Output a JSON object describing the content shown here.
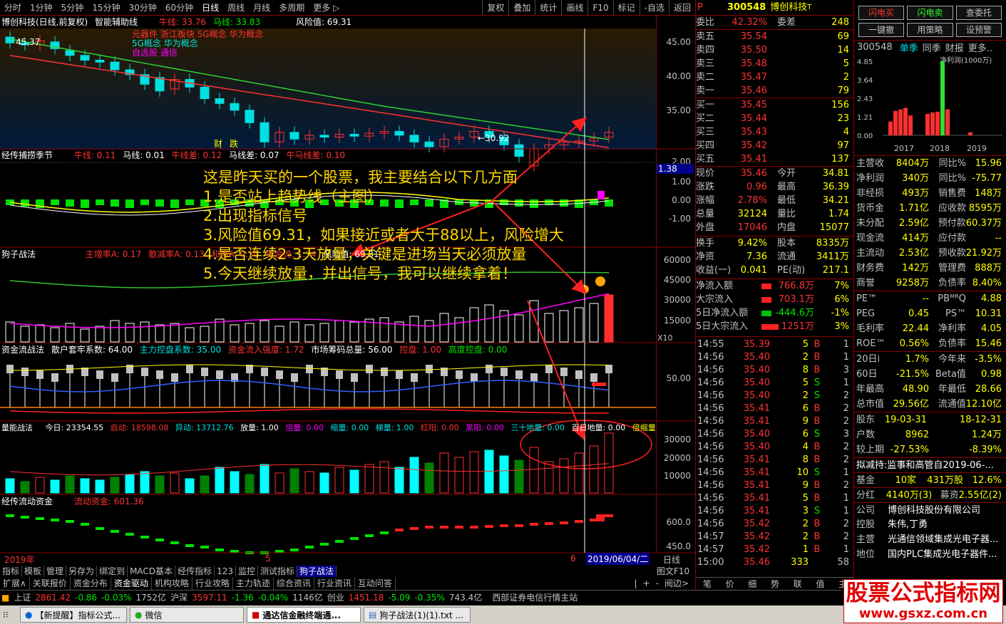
{
  "topbar": {
    "periods": [
      "分时",
      "1分钟",
      "5分钟",
      "15分钟",
      "30分钟",
      "60分钟",
      "日线",
      "周线",
      "月线",
      "多周期",
      "更多 ▷"
    ],
    "active_period": "日线",
    "tools": [
      "复权",
      "叠加",
      "统计",
      "画线",
      "F10",
      "标记",
      "-自选",
      "返回"
    ]
  },
  "main_panel": {
    "title": "博创科技(日线,前复权)",
    "indicator": "智能辅助线",
    "niu": "牛线: 33.76",
    "ma": "马线: 33.83",
    "risk": "风险值: 69.31",
    "concepts": [
      "元器件 浙江板块 5G概念 华为概念",
      "5G概念 华为概念",
      "自选股 通信"
    ],
    "price_high": "45.37",
    "price_low": "←30.92",
    "markers": [
      "财",
      "跌"
    ],
    "axis": [
      "45.00",
      "40.00",
      "35.00"
    ]
  },
  "panel2": {
    "title": "经传捕捞季节",
    "vals": [
      "牛线: 0.11",
      "马线: 0.01",
      "牛线差: 0.12",
      "马线差: 0.07",
      "牛马线差: 0.10"
    ],
    "axis": [
      "2.00",
      "1.00",
      "0.00",
      "-1.00"
    ],
    "badge": "1.38"
  },
  "panel3": {
    "title": "狗子战法",
    "vals": [
      "主增率A: 0.17",
      "散减率A: 0.13",
      "和率A: 0.30",
      "资金流: 1.74",
      "风险值: 69.31"
    ],
    "axis": [
      "60000",
      "45000",
      "30000",
      "15000"
    ],
    "scale": "X10"
  },
  "panel4": {
    "title": "资金流战法",
    "vals": [
      "散户套牢系数: 64.00",
      "主力控盘系数: 35.00",
      "资金流入强度: 1.72",
      "市场筹码总量: 56.00",
      "控盘: 1.00",
      "高度控盘: 0.00"
    ],
    "axis": [
      "50.00"
    ]
  },
  "panel5": {
    "title": "量能战法",
    "vals": [
      "今日: 23354.55",
      "启动: 18598.08",
      "异动: 13712.76",
      "放量: 1.00",
      "倍量: 0.00",
      "缩量: 0.00",
      "梯量: 1.00",
      "红阳: 0.00",
      "黑阳: 0.00",
      "三十地量: 0.00",
      "百日地量: 0.00",
      "倍缩量"
    ],
    "axis": [
      "30000",
      "20000",
      "10000"
    ]
  },
  "panel6": {
    "title": "经传流动资金",
    "vals": [
      "流动资金: 601.36"
    ],
    "axis": [
      "600.0",
      "450.0"
    ]
  },
  "xaxis": {
    "year": "2019年",
    "m5": "5",
    "m6": "6",
    "cursor": "2019/06/04/二",
    "right": "日线"
  },
  "bottom_tabs": [
    "指标",
    "模板",
    "管理",
    "另存为",
    "绑定到",
    "MACD基本",
    "经传指标",
    "123",
    "监控",
    "测试指标",
    "狗子战法"
  ],
  "bottom_tabs2": [
    "扩展∧",
    "关联报价",
    "资金分布",
    "资金驱动",
    "机构攻略",
    "行业攻略",
    "主力轨迹",
    "综合资讯",
    "行业资讯",
    "互动问答"
  ],
  "bottom_right": [
    "图文F10",
    "|",
    "+",
    "-",
    "阅边>"
  ],
  "annotation": [
    "这是昨天买的一个股票，我主要结合以下几方面",
    "1.是否站上趋势线（主图）",
    "2.出现指标信号",
    "3.风险值69.31，如果接近或者大于88以上，风险增大",
    "4.是否连续2-3天放量，关键是进场当天必须放量",
    "5.今天继续放量，并出信号，我可以继续拿着！"
  ],
  "quote": {
    "code": "300548",
    "name": "博创科技",
    "weibi": [
      "委比",
      "42.32%",
      "委差",
      "248"
    ],
    "sells": [
      [
        "卖五",
        "35.54",
        "69"
      ],
      [
        "卖四",
        "35.50",
        "14"
      ],
      [
        "卖三",
        "35.48",
        "5"
      ],
      [
        "卖二",
        "35.47",
        "2"
      ],
      [
        "卖一",
        "35.46",
        "79"
      ]
    ],
    "buys": [
      [
        "买一",
        "35.45",
        "156"
      ],
      [
        "买二",
        "35.44",
        "23"
      ],
      [
        "买三",
        "35.43",
        "4"
      ],
      [
        "买四",
        "35.42",
        "97"
      ],
      [
        "买五",
        "35.41",
        "137"
      ]
    ],
    "stats": [
      [
        "现价",
        "35.46",
        "今开",
        "34.81"
      ],
      [
        "涨跌",
        "0.96",
        "最高",
        "36.39"
      ],
      [
        "涨幅",
        "2.78%",
        "最低",
        "34.21"
      ],
      [
        "总量",
        "32124",
        "量比",
        "1.74"
      ],
      [
        "外盘",
        "17046",
        "内盘",
        "15077"
      ]
    ],
    "stats2": [
      [
        "换手",
        "9.42%",
        "股本",
        "8335万"
      ],
      [
        "净资",
        "7.36",
        "流通",
        "3411万"
      ],
      [
        "收益(一)",
        "0.041",
        "PE(动)",
        "217.1"
      ]
    ],
    "flows": [
      [
        "净流入额",
        "766.8万",
        "7%"
      ],
      [
        "大宗流入",
        "703.1万",
        "6%"
      ],
      [
        "5日净流入额",
        "-444.6万",
        "-1%"
      ],
      [
        "5日大宗流入",
        "1251万",
        "3%"
      ]
    ],
    "ticks": [
      [
        "14:55",
        "35.39",
        "5",
        "B",
        "1"
      ],
      [
        "14:56",
        "35.40",
        "2",
        "B",
        "1"
      ],
      [
        "14:56",
        "35.40",
        "8",
        "B",
        "3"
      ],
      [
        "14:56",
        "35.40",
        "5",
        "S",
        "1"
      ],
      [
        "14:56",
        "35.40",
        "2",
        "S",
        "2"
      ],
      [
        "14:56",
        "35.41",
        "6",
        "B",
        "2"
      ],
      [
        "14:56",
        "35.41",
        "9",
        "B",
        "2"
      ],
      [
        "14:56",
        "35.40",
        "6",
        "S",
        "3"
      ],
      [
        "14:56",
        "35.40",
        "4",
        "B",
        "2"
      ],
      [
        "14:56",
        "35.41",
        "8",
        "B",
        "2"
      ],
      [
        "14:56",
        "35.41",
        "10",
        "S",
        "1"
      ],
      [
        "14:56",
        "35.41",
        "9",
        "B",
        "2"
      ],
      [
        "14:56",
        "35.41",
        "5",
        "B",
        "1"
      ],
      [
        "14:56",
        "35.41",
        "3",
        "S",
        "1"
      ],
      [
        "14:56",
        "35.42",
        "2",
        "B",
        "2"
      ],
      [
        "14:57",
        "35.42",
        "2",
        "B",
        "2"
      ],
      [
        "14:57",
        "35.42",
        "1",
        "B",
        "1"
      ],
      [
        "15:00",
        "35.46",
        "333",
        "",
        "58"
      ]
    ],
    "bottom_tabs": [
      "笔",
      "价",
      "细",
      "势",
      "联",
      "值",
      "主"
    ]
  },
  "fin": {
    "buttons": [
      "闪电买",
      "闪电卖",
      "查委托",
      "一键撤",
      "用策略",
      "设预警"
    ],
    "code": "300548",
    "period_tabs": [
      "单季",
      "同季",
      "财报",
      "更多.."
    ],
    "chart_title": "净利润(1000万)",
    "y_ticks": [
      "4.85",
      "3.64",
      "2.43",
      "1.21",
      "0.00"
    ],
    "years": [
      "2017",
      "2018",
      "2019"
    ],
    "rows": [
      [
        "主营收",
        "8404万",
        "同比%",
        "15.96"
      ],
      [
        "净利润",
        "340万",
        "同比%",
        "-75.77"
      ],
      [
        "非经损",
        "493万",
        "销售费",
        "148万"
      ],
      [
        "货币金",
        "1.71亿",
        "应收款",
        "8595万"
      ],
      [
        "未分配",
        "2.59亿",
        "预付款",
        "60.37万"
      ],
      [
        "现金流",
        "414万",
        "应付款",
        "--"
      ],
      [
        "主流动",
        "2.53亿",
        "预收款",
        "21.92万"
      ],
      [
        "财务费",
        "142万",
        "管理费",
        "888万"
      ],
      [
        "商誉",
        "9258万",
        "负债率",
        "8.40%"
      ]
    ],
    "rows2": [
      [
        "PE™",
        "--",
        "PBᴹᴿQ",
        "4.88"
      ],
      [
        "PEG",
        "0.45",
        "PS™",
        "10.31"
      ],
      [
        "毛利率",
        "22.44",
        "净利率",
        "4.05"
      ],
      [
        "ROE™",
        "0.56%",
        "负债率",
        "15.46"
      ]
    ],
    "rows3": [
      [
        "20日i",
        "1.7%",
        "今年来",
        "-3.5%"
      ],
      [
        "60日",
        "-21.5%",
        "Beta值",
        "0.98"
      ],
      [
        "年最高",
        "48.90",
        "年最低",
        "28.66"
      ],
      [
        "总市值",
        "29.56亿",
        "流通值",
        "12.10亿"
      ]
    ],
    "rows4": [
      [
        "股东",
        "19-03-31",
        "",
        "18-12-31"
      ],
      [
        "户数",
        "8962",
        "",
        "1.24万"
      ],
      [
        "较上期",
        "-27.53%",
        "",
        "-8.39%"
      ]
    ],
    "reduce": "拟减持:监事和高管自2019-06-...",
    "fund": [
      "基金",
      "10家",
      "431万股",
      "12.6%"
    ],
    "dividend": [
      "分红",
      "4140万(3)",
      "募资",
      "2.55亿(2)"
    ],
    "company": [
      "公司",
      "博创科技股份有限公司"
    ],
    "holder": [
      "控股",
      "朱伟,丁勇"
    ],
    "business": [
      "主营",
      "光通信领域集成光电子器..."
    ],
    "position": [
      "地位",
      "国内PLC集成光电子器件..."
    ]
  },
  "status": {
    "items": [
      [
        "上证",
        "2861.42",
        "-0.86",
        "-0.03%",
        "1752亿"
      ],
      [
        "沪深",
        "3597.11",
        "-1.36",
        "-0.04%",
        "1146亿"
      ],
      [
        "创业",
        "1451.18",
        "-5.09",
        "-0.35%",
        "743.4亿"
      ]
    ],
    "broker": "西部证券电信行情主站"
  },
  "taskbar": [
    "【新提醒】指标公式...",
    "微信",
    "通达信金融终端通...",
    "狗子战法(1)(1).txt ..."
  ],
  "watermark": {
    "text": "股票公式指标网",
    "url": "www.gsxz.com.cn"
  }
}
